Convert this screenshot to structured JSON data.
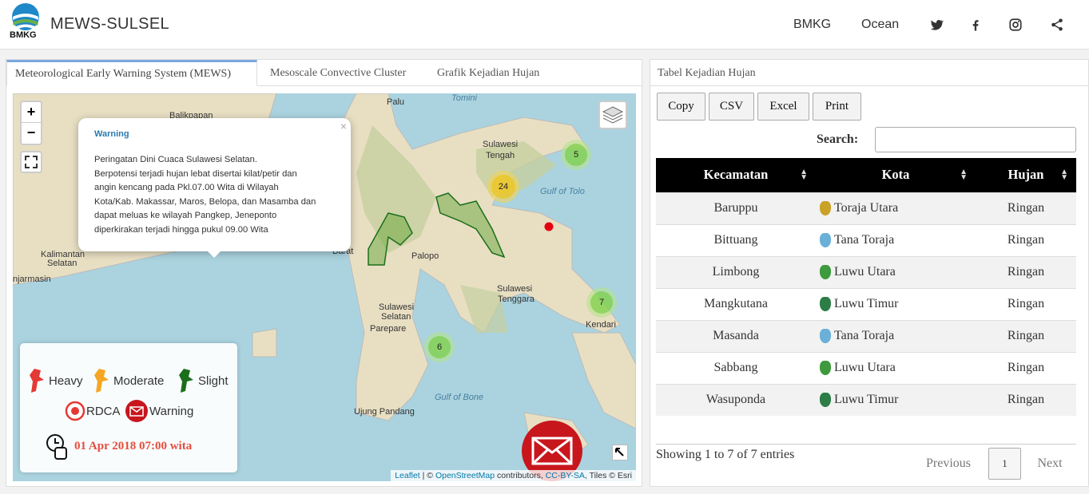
{
  "navbar": {
    "logo_text": "BMKG",
    "title": "MEWS-SULSEL",
    "links": [
      "BMKG",
      "Ocean"
    ],
    "icons": [
      "twitter-icon",
      "facebook-icon",
      "instagram-icon",
      "share-icon"
    ]
  },
  "tabs": [
    {
      "label": "Meteorological Early Warning System (MEWS)",
      "active": true
    },
    {
      "label": "Mesoscale Convective Cluster",
      "active": false
    },
    {
      "label": "Grafik Kejadian Hujan",
      "active": false
    }
  ],
  "map": {
    "zoom_in": "+",
    "zoom_out": "−",
    "popup": {
      "title": "Warning",
      "close": "×",
      "body_lines": [
        "Peringatan Dini Cuaca Sulawesi Selatan.",
        "Berpotensi terjadi hujan lebat disertai kilat/petir dan",
        "angin kencang pada Pkl.07.00 Wita di Wilayah",
        "Kota/Kab. Makassar, Maros, Belopa, dan Masamba dan",
        "dapat meluas ke wilayah Pangkep, Jeneponto",
        "diperkirakan terjadi hingga pukul 09.00 Wita"
      ]
    },
    "places": {
      "palu": "Palu",
      "tomini": "Tomini",
      "sulteng_1": "Sulawesi",
      "sulteng_2": "Tengah",
      "tolo": "Gulf of Tolo",
      "kalsel_1": "Kalimantan",
      "kalsel_2": "Selatan",
      "banjarmasin": "njarmasin",
      "palopo": "Palopo",
      "sultra_1": "Sulawesi",
      "sultra_2": "Tenggara",
      "kendari": "Kendari",
      "sulsel_1": "Sulawesi",
      "sulsel_2": "Selatan",
      "parepare": "Parepare",
      "bone": "Gulf of Bone",
      "ujung_pandang": "Ujung Pandang",
      "balikpapan": "Balikpapan",
      "barat": "Barat"
    },
    "clusters": [
      {
        "count": "5",
        "color": "green"
      },
      {
        "count": "24",
        "color": "yellow"
      },
      {
        "count": "7",
        "color": "green"
      },
      {
        "count": "6",
        "color": "green"
      }
    ],
    "legend": {
      "heavy": "Heavy",
      "moderate": "Moderate",
      "slight": "Slight",
      "rdca": "RDCA",
      "warning": "Warning",
      "datetime": "01 Apr 2018 07:00 wita",
      "colors": {
        "heavy": "#e53935",
        "moderate": "#f5a623",
        "slight": "#1b6e1b"
      }
    },
    "attribution": {
      "leaflet": "Leaflet",
      "sep": " | © ",
      "osm": "OpenStreetMap",
      "contrib": " contributors, ",
      "license": "CC-BY-SA",
      "tiles": ", Tiles © Esri"
    }
  },
  "table_panel": {
    "title": "Tabel Kejadian Hujan",
    "buttons": [
      "Copy",
      "CSV",
      "Excel",
      "Print"
    ],
    "search_label": "Search:",
    "search_value": "",
    "columns": [
      "Kecamatan",
      "Kota",
      "Hujan"
    ],
    "rows": [
      {
        "kecamatan": "Baruppu",
        "kota": "Toraja Utara",
        "hujan": "Ringan"
      },
      {
        "kecamatan": "Bittuang",
        "kota": "Tana Toraja",
        "hujan": "Ringan"
      },
      {
        "kecamatan": "Limbong",
        "kota": "Luwu Utara",
        "hujan": "Ringan"
      },
      {
        "kecamatan": "Mangkutana",
        "kota": "Luwu Timur",
        "hujan": "Ringan"
      },
      {
        "kecamatan": "Masanda",
        "kota": "Tana Toraja",
        "hujan": "Ringan"
      },
      {
        "kecamatan": "Sabbang",
        "kota": "Luwu Utara",
        "hujan": "Ringan"
      },
      {
        "kecamatan": "Wasuponda",
        "kota": "Luwu Timur",
        "hujan": "Ringan"
      }
    ],
    "info": "Showing 1 to 7 of 7 entries",
    "pagination": {
      "previous": "Previous",
      "current": "1",
      "next": "Next"
    }
  }
}
